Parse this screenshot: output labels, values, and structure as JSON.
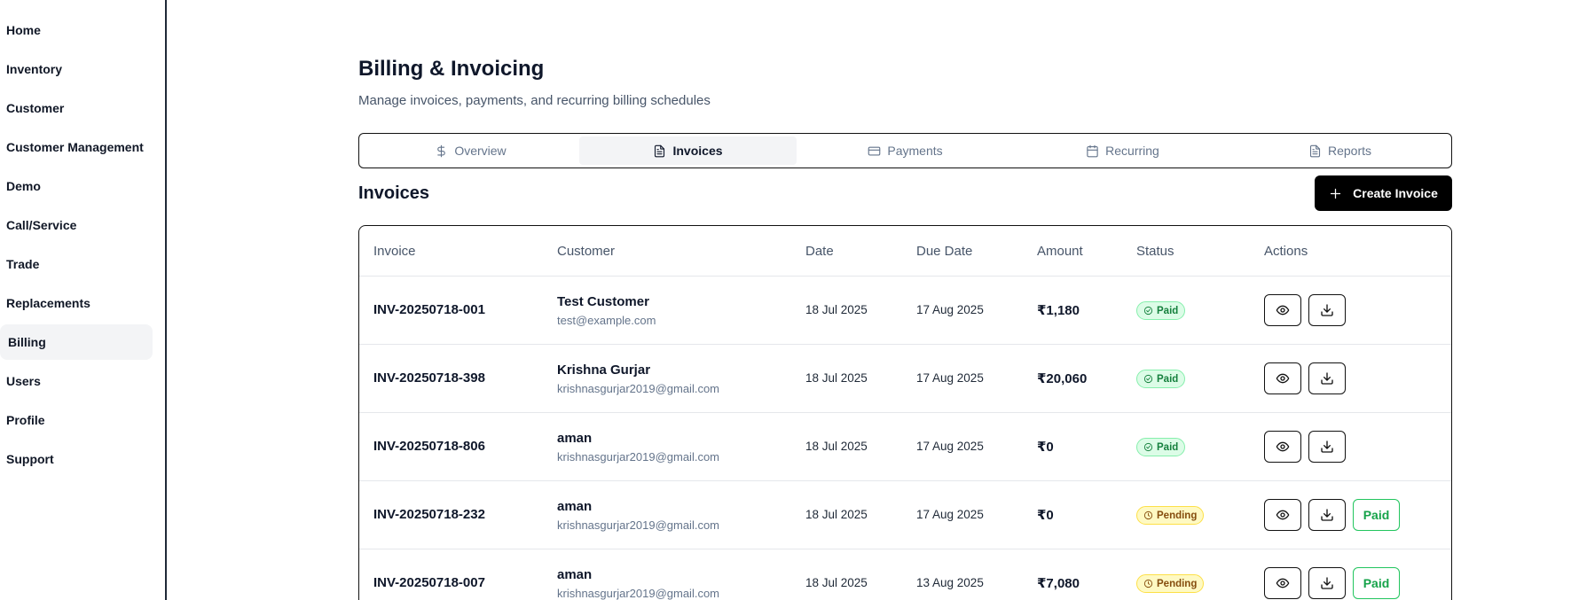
{
  "sidebar": {
    "items": [
      {
        "label": "Home"
      },
      {
        "label": "Inventory"
      },
      {
        "label": "Customer"
      },
      {
        "label": "Customer Management"
      },
      {
        "label": "Demo"
      },
      {
        "label": "Call/Service"
      },
      {
        "label": "Trade"
      },
      {
        "label": "Replacements"
      },
      {
        "label": "Billing",
        "active": true
      },
      {
        "label": "Users"
      },
      {
        "label": "Profile"
      },
      {
        "label": "Support"
      }
    ]
  },
  "header": {
    "title": "Billing & Invoicing",
    "subtitle": "Manage invoices, payments, and recurring billing schedules"
  },
  "tabs": [
    {
      "label": "Overview",
      "icon": "dollar-icon"
    },
    {
      "label": "Invoices",
      "icon": "file-text-icon",
      "active": true
    },
    {
      "label": "Payments",
      "icon": "credit-card-icon"
    },
    {
      "label": "Recurring",
      "icon": "calendar-icon"
    },
    {
      "label": "Reports",
      "icon": "file-text-icon"
    }
  ],
  "invoices": {
    "title": "Invoices",
    "create_label": "Create Invoice",
    "columns": [
      "Invoice",
      "Customer",
      "Date",
      "Due Date",
      "Amount",
      "Status",
      "Actions"
    ],
    "rows": [
      {
        "invoice": "INV-20250718-001",
        "customer": "Test Customer",
        "email": "test@example.com",
        "date": "18 Jul 2025",
        "due_date": "17 Aug 2025",
        "amount": "₹1,180",
        "status": "Paid",
        "mark_paid": ""
      },
      {
        "invoice": "INV-20250718-398",
        "customer": "Krishna Gurjar",
        "email": "krishnasgurjar2019@gmail.com",
        "date": "18 Jul 2025",
        "due_date": "17 Aug 2025",
        "amount": "₹20,060",
        "status": "Paid",
        "mark_paid": ""
      },
      {
        "invoice": "INV-20250718-806",
        "customer": "aman",
        "email": "krishnasgurjar2019@gmail.com",
        "date": "18 Jul 2025",
        "due_date": "17 Aug 2025",
        "amount": "₹0",
        "status": "Paid",
        "mark_paid": ""
      },
      {
        "invoice": "INV-20250718-232",
        "customer": "aman",
        "email": "krishnasgurjar2019@gmail.com",
        "date": "18 Jul 2025",
        "due_date": "17 Aug 2025",
        "amount": "₹0",
        "status": "Pending",
        "mark_paid": "Paid"
      },
      {
        "invoice": "INV-20250718-007",
        "customer": "aman",
        "email": "krishnasgurjar2019@gmail.com",
        "date": "18 Jul 2025",
        "due_date": "13 Aug 2025",
        "amount": "₹7,080",
        "status": "Pending",
        "mark_paid": "Paid"
      }
    ]
  },
  "colors": {
    "primary_button": "#000000",
    "paid_badge": "#dcfce7",
    "pending_badge": "#fef9c3",
    "active_tab": "#f3f4f6"
  }
}
